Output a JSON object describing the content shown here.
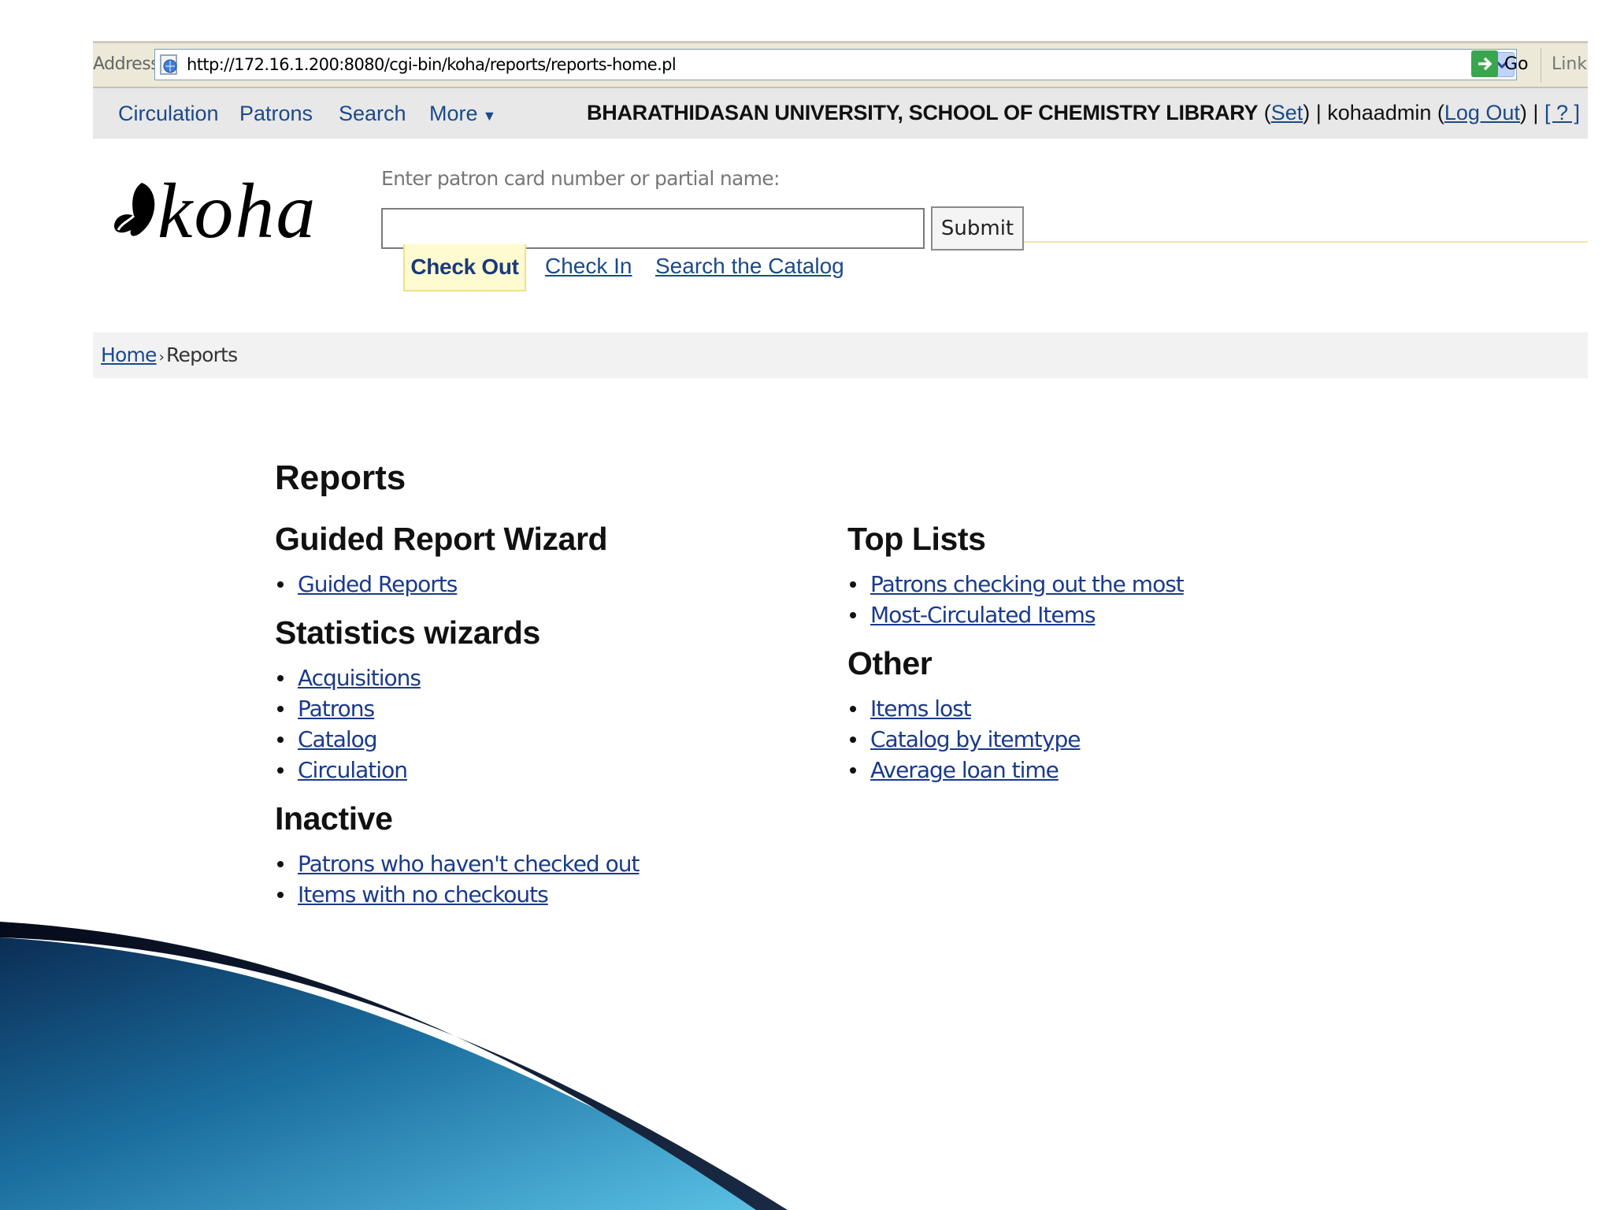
{
  "browser": {
    "address_label": "Address",
    "url": "http://172.16.1.200:8080/cgi-bin/koha/reports/reports-home.pl",
    "go_label": "Go",
    "links_label": "Links"
  },
  "nav": {
    "items": [
      "Circulation",
      "Patrons",
      "Search",
      "More"
    ],
    "library_name": "BHARATHIDASAN UNIVERSITY, SCHOOL OF CHEMISTRY LIBRARY",
    "set_label": "Set",
    "user": "kohaadmin",
    "logout_label": "Log Out",
    "help_label": "?"
  },
  "header": {
    "logo_text": "koha",
    "patron_prompt": "Enter patron card number or partial name:",
    "patron_input_value": "",
    "submit_label": "Submit",
    "tabs": [
      "Check Out",
      "Check In",
      "Search the Catalog"
    ]
  },
  "breadcrumb": {
    "home": "Home",
    "separator": "›",
    "current": "Reports"
  },
  "main": {
    "title": "Reports",
    "left_sections": [
      {
        "heading": "Guided Report Wizard",
        "links": [
          "Guided Reports"
        ]
      },
      {
        "heading": "Statistics wizards",
        "links": [
          "Acquisitions",
          "Patrons",
          "Catalog",
          "Circulation"
        ]
      },
      {
        "heading": "Inactive",
        "links": [
          "Patrons who haven't checked out",
          "Items with no checkouts"
        ]
      }
    ],
    "right_sections": [
      {
        "heading": "Top Lists",
        "links": [
          "Patrons checking out the most",
          "Most-Circulated Items"
        ]
      },
      {
        "heading": "Other",
        "links": [
          "Items lost",
          "Catalog by itemtype",
          "Average loan time"
        ]
      }
    ]
  },
  "colors": {
    "link": "#1a4a8a",
    "active_tab_bg": "#fffbd0",
    "nav_bg": "#e8e8e8",
    "swoosh_dark": "#0a1a3a",
    "swoosh_light": "#4ab0d8"
  },
  "icons": {
    "favicon": "ie-page-icon",
    "dropdown": "chevron-down-icon",
    "go": "arrow-right-icon",
    "logo_mark": "koha-leaf-icon"
  }
}
